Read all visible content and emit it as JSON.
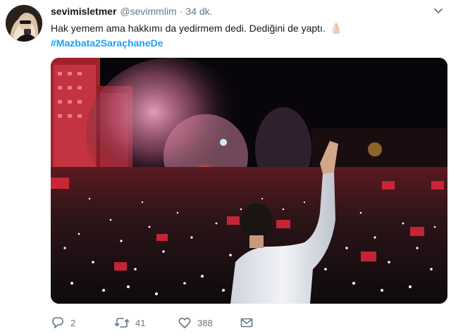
{
  "tweet": {
    "display_name": "sevimisletmer",
    "handle": "@sevimmlim",
    "separator": "·",
    "time": "34 dk.",
    "text": "Hak yemem ama hakkımı da yedirmem dedi. Dediğini de yaptı.",
    "hashtag": "#Mazbata2SaraçhaneDe",
    "avatar_icon": "avatar-photo",
    "media_description_icon": "crowd-photo",
    "emoji_icon": "folded-hands-emoji"
  },
  "actions": {
    "reply_count": "2",
    "retweet_count": "41",
    "like_count": "388",
    "reply_icon": "reply-icon",
    "retweet_icon": "retweet-icon",
    "like_icon": "heart-icon",
    "dm_icon": "envelope-icon"
  },
  "colors": {
    "text": "#14171a",
    "muted": "#657786",
    "link": "#1da1f2",
    "background": "#ffffff"
  }
}
